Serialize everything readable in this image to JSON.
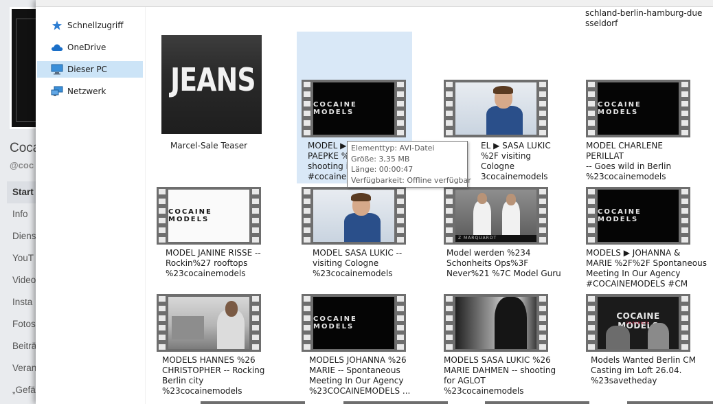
{
  "background_page": {
    "page_name": "Coca",
    "page_handle": "@coc",
    "nav_items": [
      {
        "label": "Start",
        "active": true
      },
      {
        "label": "Info",
        "active": false
      },
      {
        "label": "Diens",
        "active": false
      },
      {
        "label": "YouT",
        "active": false
      },
      {
        "label": "Video",
        "active": false
      },
      {
        "label": "Insta",
        "active": false
      },
      {
        "label": "Fotos",
        "active": false
      },
      {
        "label": "Beiträ",
        "active": false
      },
      {
        "label": "Veran",
        "active": false
      },
      {
        "label": "„Gefä",
        "active": false
      }
    ]
  },
  "sidebar": {
    "items": [
      {
        "label": "Schnellzugriff",
        "icon": "star-icon",
        "selected": false
      },
      {
        "label": "OneDrive",
        "icon": "cloud-icon",
        "selected": false
      },
      {
        "label": "Dieser PC",
        "icon": "computer-icon",
        "selected": true
      },
      {
        "label": "Netzwerk",
        "icon": "network-icon",
        "selected": false
      }
    ]
  },
  "top_partial": {
    "right_text": "schland-berlin-hamburg-due\nsseldorf"
  },
  "files": [
    {
      "name": "Marcel-Sale Teaser",
      "thumb": "jeans",
      "thumb_text": "JEANS"
    },
    {
      "name": "MODEL ▶ \nPAEPKE %2\nshooting in\n#cocainem",
      "thumb": "black",
      "thumb_text": "COCAINE MODELS",
      "hovered": true
    },
    {
      "name": "EL ▶ SASA LUKIC\n%2F visiting Cologne\n3cocainemodels",
      "thumb": "man",
      "thumb_text": ""
    },
    {
      "name": "MODEL CHARLENE PERILLAT\n-- Goes wild in Berlin\n%23cocainemodels",
      "thumb": "black",
      "thumb_text": "COCAINE MODELS"
    },
    {
      "name": "MODEL JANINE RISSE --\nRockin%27 rooftops\n%23cocainemodels",
      "thumb": "white",
      "thumb_text": "COCAINE MODELS"
    },
    {
      "name": "MODEL SASA LUKIC --\nvisiting Cologne\n%23cocainemodels",
      "thumb": "man",
      "thumb_text": ""
    },
    {
      "name": "Model werden %234\nSchonheits Ops%3F\nNever%21 %7C Model Guru",
      "thumb": "duo",
      "thumb_text": "Z MARQUARDT"
    },
    {
      "name": "MODELS ▶ JOHANNA &\nMARIE %2F%2F Spontaneous\nMeeting In Our Agency\n#COCAINEMODELS #CM",
      "thumb": "black",
      "thumb_text": "COCAINE MODELS"
    },
    {
      "name": "MODELS HANNES %26\nCHRISTOPHER -- Rocking\nBerlin city\n%23cocainemodels",
      "thumb": "city",
      "thumb_text": ""
    },
    {
      "name": "MODELS JOHANNA %26\nMARIE -- Spontaneous\nMeeting In Our Agency\n%23COCAINEMODELS ...",
      "thumb": "black",
      "thumb_text": "COCAINE MODELS"
    },
    {
      "name": "MODELS SASA LUKIC %26\nMARIE DAHMEN -- shooting\nfor AGLOT\n%23cocainemodels",
      "thumb": "bw",
      "thumb_text": ""
    },
    {
      "name": "Models Wanted Berlin CM\nCasting im Loft 26.04.\n%23savetheday",
      "thumb": "poster",
      "thumb_text": "COCAINE MODELS",
      "thumb_sub": "PRESENTS"
    }
  ],
  "tooltip": {
    "type_line": "Elementtyp: AVI-Datei",
    "size_line": "Größe: 3,35 MB",
    "length_line": "Länge: 00:00:47",
    "availability_line": "Verfügbarkeit: Offline verfügbar"
  }
}
